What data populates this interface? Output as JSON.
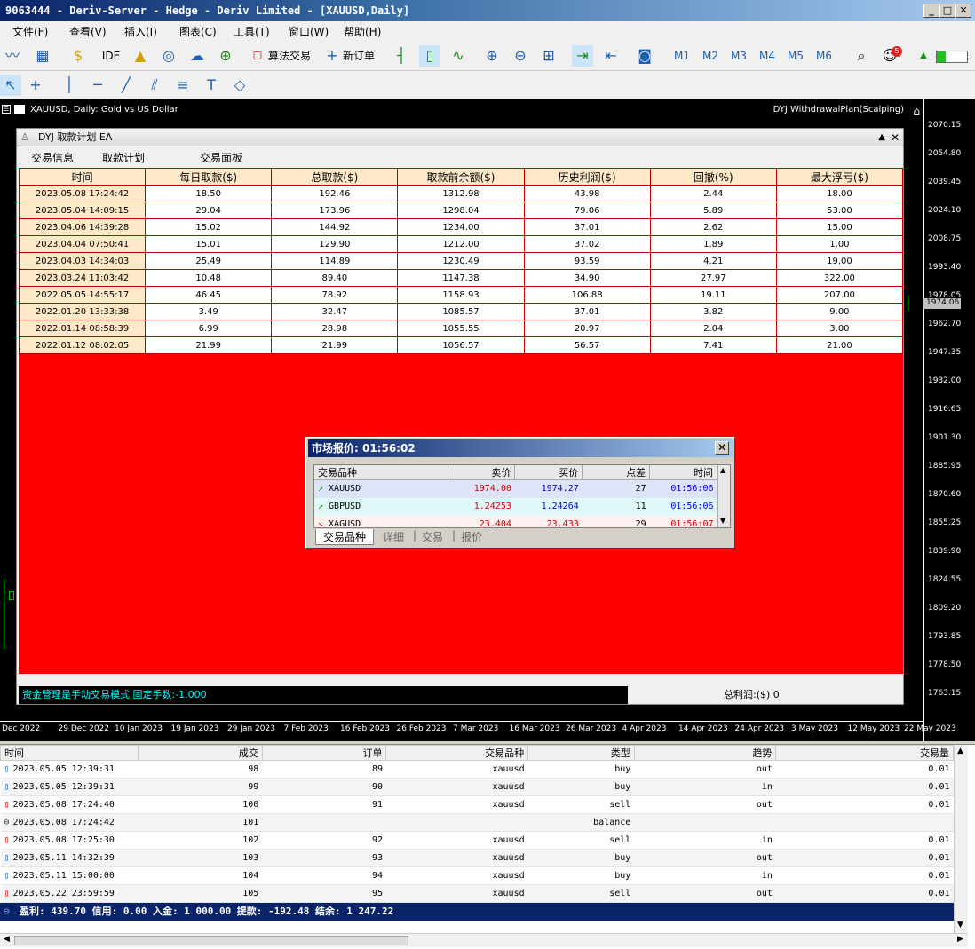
{
  "window": {
    "title": "9063444 - Deriv-Server - Hedge - Deriv Limited - [XAUUSD,Daily]"
  },
  "menu": [
    "文件(F)",
    "查看(V)",
    "插入(I)",
    "图表(C)",
    "工具(T)",
    "窗口(W)",
    "帮助(H)"
  ],
  "toolbar": {
    "ide": "IDE",
    "algo": "算法交易",
    "new_order": "新订单",
    "periods": [
      "M1",
      "M2",
      "M3",
      "M4",
      "M5",
      "M6"
    ],
    "notif_count": "5"
  },
  "chart": {
    "title": "XAUUSD, Daily:  Gold vs US Dollar",
    "ea_label": "DYJ WithdrawalPlan(Scalping)",
    "current_price": "1974.06",
    "price_ticks": [
      "2070.15",
      "2054.80",
      "2039.45",
      "2024.10",
      "2008.75",
      "1993.40",
      "1978.05",
      "1962.70",
      "1947.35",
      "1932.00",
      "1916.65",
      "1901.30",
      "1885.95",
      "1870.60",
      "1855.25",
      "1839.90",
      "1824.55",
      "1809.20",
      "1793.85",
      "1778.50",
      "1763.15"
    ],
    "date_ticks": [
      "Dec 2022",
      "29 Dec 2022",
      "10 Jan 2023",
      "19 Jan 2023",
      "29 Jan 2023",
      "7 Feb 2023",
      "16 Feb 2023",
      "26 Feb 2023",
      "7 Mar 2023",
      "16 Mar 2023",
      "26 Mar 2023",
      "4 Apr 2023",
      "14 Apr 2023",
      "24 Apr 2023",
      "3 May 2023",
      "12 May 2023",
      "22 May 2023"
    ]
  },
  "panel": {
    "title": "DYJ 取款计划 EA",
    "tabs": [
      "交易信息",
      "取款计划",
      "交易面板"
    ],
    "columns": [
      "时间",
      "每日取款($)",
      "总取款($)",
      "取款前余额($)",
      "历史利润($)",
      "回撤(%)",
      "最大浮亏($)"
    ],
    "rows": [
      [
        "2023.05.08 17:24:42",
        "18.50",
        "192.46",
        "1312.98",
        "43.98",
        "2.44",
        "18.00"
      ],
      [
        "2023.05.04 14:09:15",
        "29.04",
        "173.96",
        "1298.04",
        "79.06",
        "5.89",
        "53.00"
      ],
      [
        "2023.04.06 14:39:28",
        "15.02",
        "144.92",
        "1234.00",
        "37.01",
        "2.62",
        "15.00"
      ],
      [
        "2023.04.04 07:50:41",
        "15.01",
        "129.90",
        "1212.00",
        "37.02",
        "1.89",
        "1.00"
      ],
      [
        "2023.04.03 14:34:03",
        "25.49",
        "114.89",
        "1230.49",
        "93.59",
        "4.21",
        "19.00"
      ],
      [
        "2023.03.24 11:03:42",
        "10.48",
        "89.40",
        "1147.38",
        "34.90",
        "27.97",
        "322.00"
      ],
      [
        "2022.05.05 14:55:17",
        "46.45",
        "78.92",
        "1158.93",
        "106.88",
        "19.11",
        "207.00"
      ],
      [
        "2022.01.20 13:33:38",
        "3.49",
        "32.47",
        "1085.57",
        "37.01",
        "3.82",
        "9.00"
      ],
      [
        "2022.01.14 08:58:39",
        "6.99",
        "28.98",
        "1055.55",
        "20.97",
        "2.04",
        "3.00"
      ],
      [
        "2022.01.12 08:02:05",
        "21.99",
        "21.99",
        "1056.57",
        "56.57",
        "7.41",
        "21.00"
      ]
    ],
    "status_text": "资金管理是手动交易模式 固定手数:-1.000",
    "total_profit": "总利润:($) 0"
  },
  "market_watch": {
    "title": "市场报价: 01:56:02",
    "columns": [
      "交易品种",
      "卖价",
      "买价",
      "点差",
      "时间"
    ],
    "rows": [
      {
        "symbol": "XAUUSD",
        "bid": "1974.00",
        "ask": "1974.27",
        "spread": "27",
        "time": "01:56:06",
        "dir": "↗",
        "bg": "#dde4f8",
        "bidColor": "#cc0000",
        "askColor": "#0000cc"
      },
      {
        "symbol": "GBPUSD",
        "bid": "1.24253",
        "ask": "1.24264",
        "spread": "11",
        "time": "01:56:06",
        "dir": "↗",
        "bg": "#dff8f8",
        "bidColor": "#cc0000",
        "askColor": "#0000cc"
      },
      {
        "symbol": "XAGUSD",
        "bid": "23.404",
        "ask": "23.433",
        "spread": "29",
        "time": "01:56:07",
        "dir": "↘",
        "bg": "#fff0f0",
        "bidColor": "#cc0000",
        "askColor": "#cc0000"
      }
    ],
    "tabs": [
      "交易品种",
      "详细",
      "交易",
      "报价"
    ]
  },
  "history": {
    "columns": [
      "时间",
      "成交",
      "订单",
      "交易品种",
      "类型",
      "趋势",
      "交易量"
    ],
    "rows": [
      [
        "2023.05.05 12:39:31",
        "98",
        "89",
        "xauusd",
        "buy",
        "out",
        "0.01"
      ],
      [
        "2023.05.05 12:39:31",
        "99",
        "90",
        "xauusd",
        "buy",
        "in",
        "0.01"
      ],
      [
        "2023.05.08 17:24:40",
        "100",
        "91",
        "xauusd",
        "sell",
        "out",
        "0.01"
      ],
      [
        "2023.05.08 17:24:42",
        "101",
        "",
        "",
        "balance",
        "",
        ""
      ],
      [
        "2023.05.08 17:25:30",
        "102",
        "92",
        "xauusd",
        "sell",
        "in",
        "0.01"
      ],
      [
        "2023.05.11 14:32:39",
        "103",
        "93",
        "xauusd",
        "buy",
        "out",
        "0.01"
      ],
      [
        "2023.05.11 15:00:00",
        "104",
        "94",
        "xauusd",
        "buy",
        "in",
        "0.01"
      ],
      [
        "2023.05.22 23:59:59",
        "105",
        "95",
        "xauusd",
        "sell",
        "out",
        "0.01"
      ]
    ],
    "summary": "盈利: 439.70  信用: 0.00  入金: 1 000.00  提款: -192.48  结余: 1 247.22"
  }
}
